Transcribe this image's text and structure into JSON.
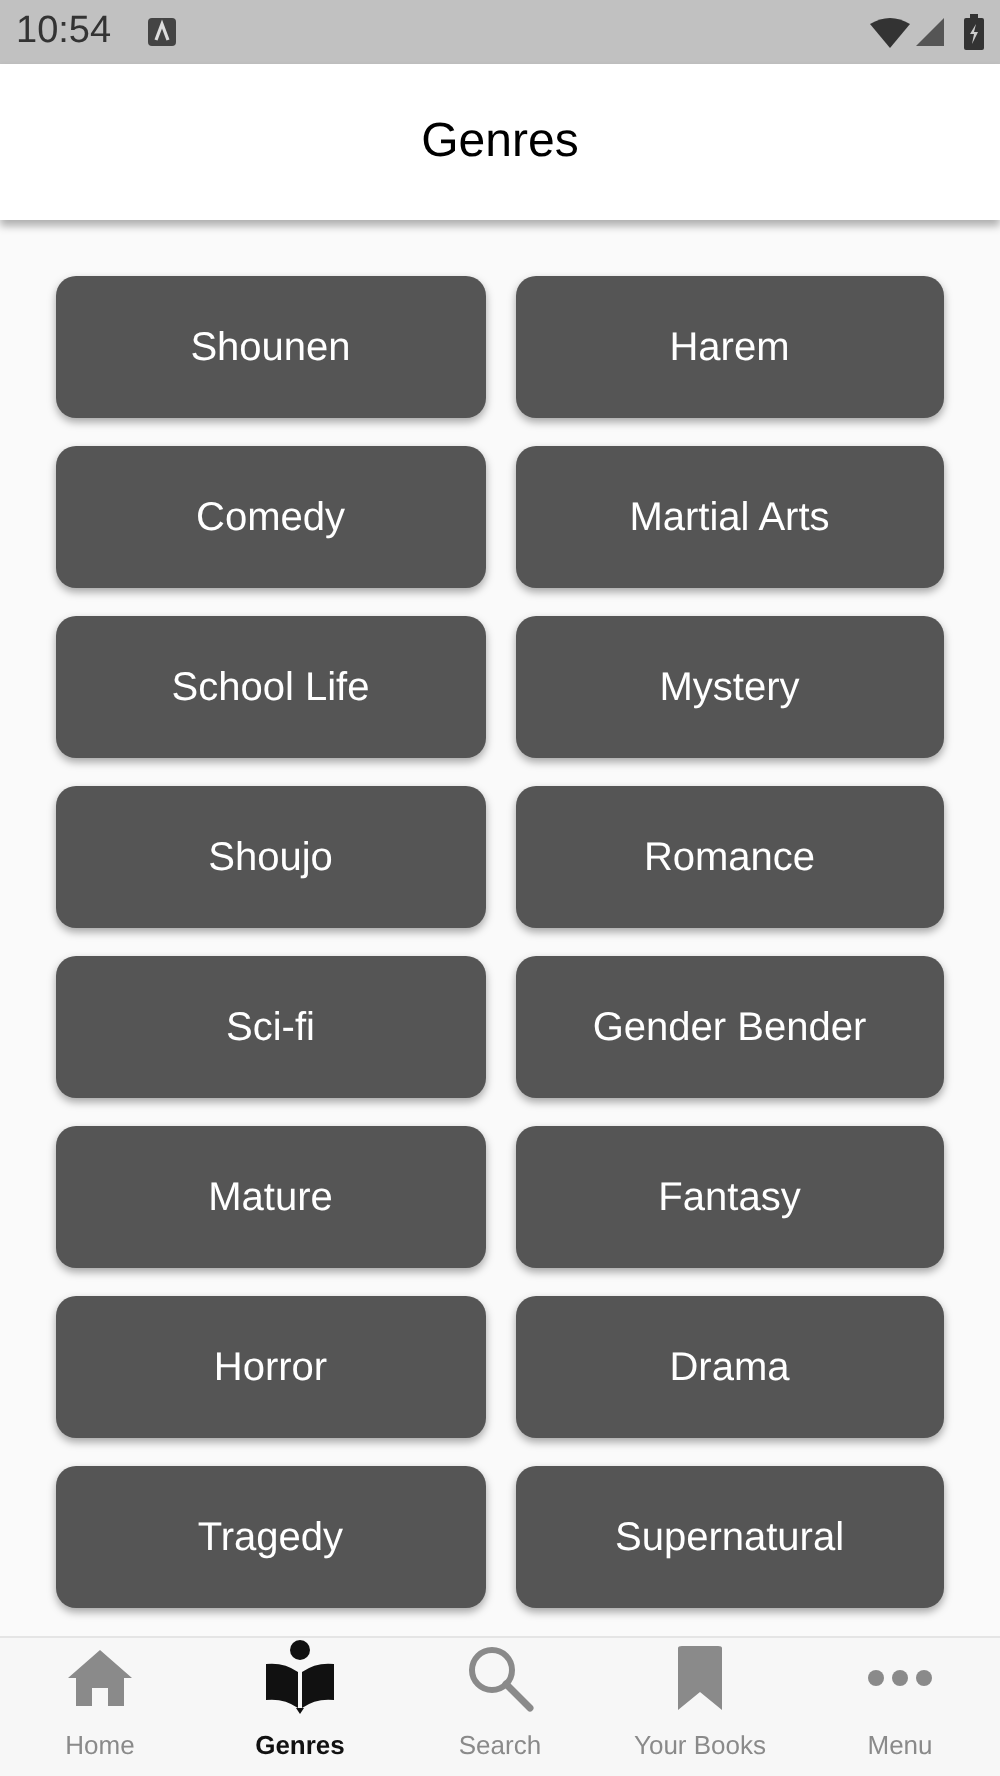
{
  "status_bar": {
    "time": "10:54"
  },
  "header": {
    "title": "Genres"
  },
  "genres": [
    "Shounen",
    "Harem",
    "Comedy",
    "Martial Arts",
    "School Life",
    "Mystery",
    "Shoujo",
    "Romance",
    "Sci-fi",
    "Gender Bender",
    "Mature",
    "Fantasy",
    "Horror",
    "Drama",
    "Tragedy",
    "Supernatural"
  ],
  "bottom_nav": [
    {
      "kind": "home",
      "label": "Home",
      "selected": false
    },
    {
      "kind": "genres",
      "label": "Genres",
      "selected": true
    },
    {
      "kind": "search",
      "label": "Search",
      "selected": false
    },
    {
      "kind": "books",
      "label": "Your Books",
      "selected": false
    },
    {
      "kind": "menu",
      "label": "Menu",
      "selected": false
    }
  ]
}
